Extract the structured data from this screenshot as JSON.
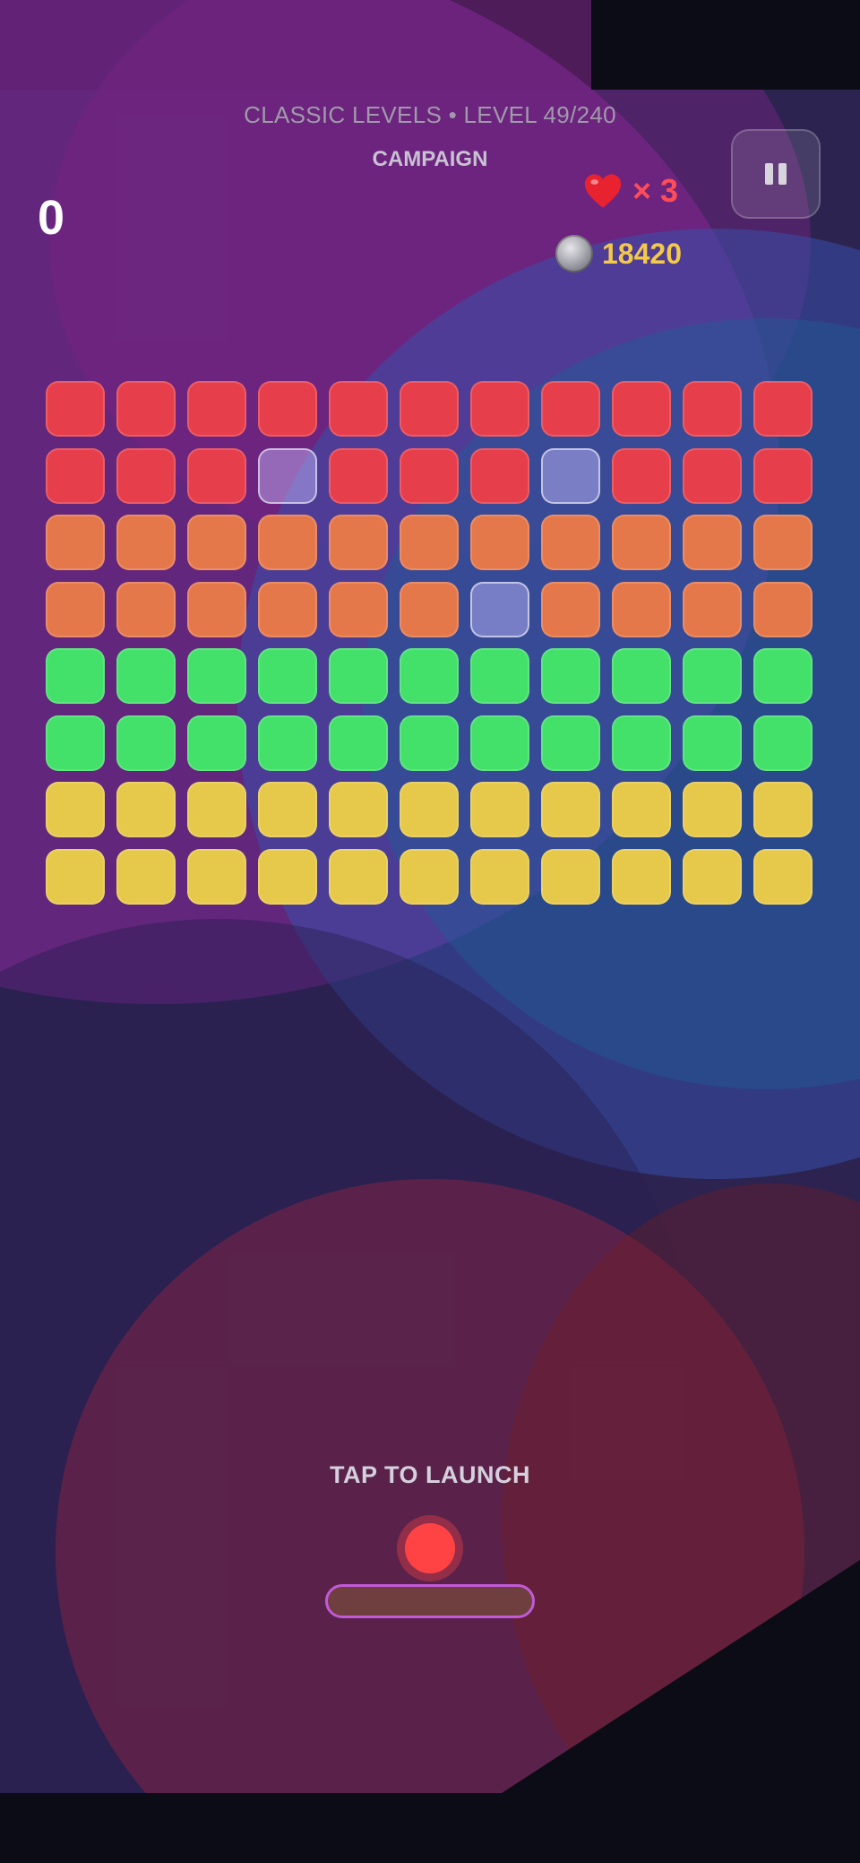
{
  "header": {
    "level_title": "CLASSIC LEVELS • LEVEL 49/240",
    "mode": "CAMPAIGN"
  },
  "hud": {
    "score": "0",
    "lives": "× 3",
    "coins": "18420",
    "heart_icon": "heart-icon",
    "coin_icon": "coin-icon",
    "pause_icon": "pause-icon"
  },
  "colors": {
    "red": "#e63e4b",
    "orange": "#e5784b",
    "green": "#43e06a",
    "yellow": "#e6c94b",
    "ball": "#ff4345",
    "paddle_border": "#c25ad8"
  },
  "bricks": {
    "columns": 11,
    "rows": [
      {
        "color": "red",
        "cells": [
          1,
          1,
          1,
          1,
          1,
          1,
          1,
          1,
          1,
          1,
          1
        ]
      },
      {
        "color": "red",
        "cells": [
          1,
          1,
          1,
          0,
          1,
          1,
          1,
          0,
          1,
          1,
          1
        ]
      },
      {
        "color": "orange",
        "cells": [
          1,
          1,
          1,
          1,
          1,
          1,
          1,
          1,
          1,
          1,
          1
        ]
      },
      {
        "color": "orange",
        "cells": [
          1,
          1,
          1,
          1,
          1,
          1,
          0,
          1,
          1,
          1,
          1
        ]
      },
      {
        "color": "green",
        "cells": [
          1,
          1,
          1,
          1,
          1,
          1,
          1,
          1,
          1,
          1,
          1
        ]
      },
      {
        "color": "green",
        "cells": [
          1,
          1,
          1,
          1,
          1,
          1,
          1,
          1,
          1,
          1,
          1
        ]
      },
      {
        "color": "yellow",
        "cells": [
          1,
          1,
          1,
          1,
          1,
          1,
          1,
          1,
          1,
          1,
          1
        ]
      },
      {
        "color": "yellow",
        "cells": [
          1,
          1,
          1,
          1,
          1,
          1,
          1,
          1,
          1,
          1,
          1
        ]
      }
    ]
  },
  "prompt": {
    "launch_text": "TAP TO LAUNCH"
  }
}
